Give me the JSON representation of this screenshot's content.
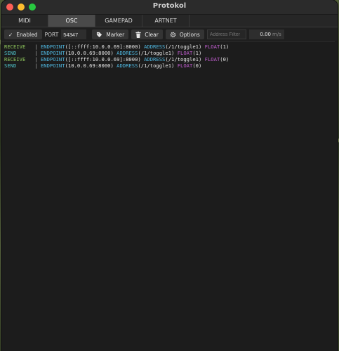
{
  "window": {
    "title": "Protokol"
  },
  "tabs": [
    {
      "label": "MIDI",
      "active": false
    },
    {
      "label": "OSC",
      "active": true
    },
    {
      "label": "GAMEPAD",
      "active": false
    },
    {
      "label": "ARTNET",
      "active": false
    }
  ],
  "toolbar": {
    "enabled_check": "✓",
    "enabled_label": "Enabled",
    "port_label": "PORT",
    "port_value": "54347",
    "marker_label": "Marker",
    "clear_label": "Clear",
    "options_label": "Options",
    "filter_placeholder": "Address Filter",
    "rate_value": "0.00",
    "rate_unit": "m/s"
  },
  "log": [
    {
      "direction": "RECEIVE",
      "type": "receive",
      "endpoint": "[::ffff:10.0.0.69]:8000",
      "address": "/1/toggle1",
      "float": "1"
    },
    {
      "direction": "SEND",
      "type": "send",
      "endpoint": "10.0.0.69:8000",
      "address": "/1/toggle1",
      "float": "1"
    },
    {
      "direction": "RECEIVE",
      "type": "receive",
      "endpoint": "[::ffff:10.0.0.69]:8000",
      "address": "/1/toggle1",
      "float": "0"
    },
    {
      "direction": "SEND",
      "type": "send",
      "endpoint": "10.0.0.69:8000",
      "address": "/1/toggle1",
      "float": "0"
    }
  ],
  "log_keywords": {
    "separator": "|",
    "endpoint": "ENDPOINT",
    "address": "ADDRESS",
    "float": "FLOAT"
  },
  "colors": {
    "receive": "#8fc75c",
    "send": "#4fc3c9",
    "keyword": "#4fb7e0",
    "float_keyword": "#c25fd0"
  }
}
